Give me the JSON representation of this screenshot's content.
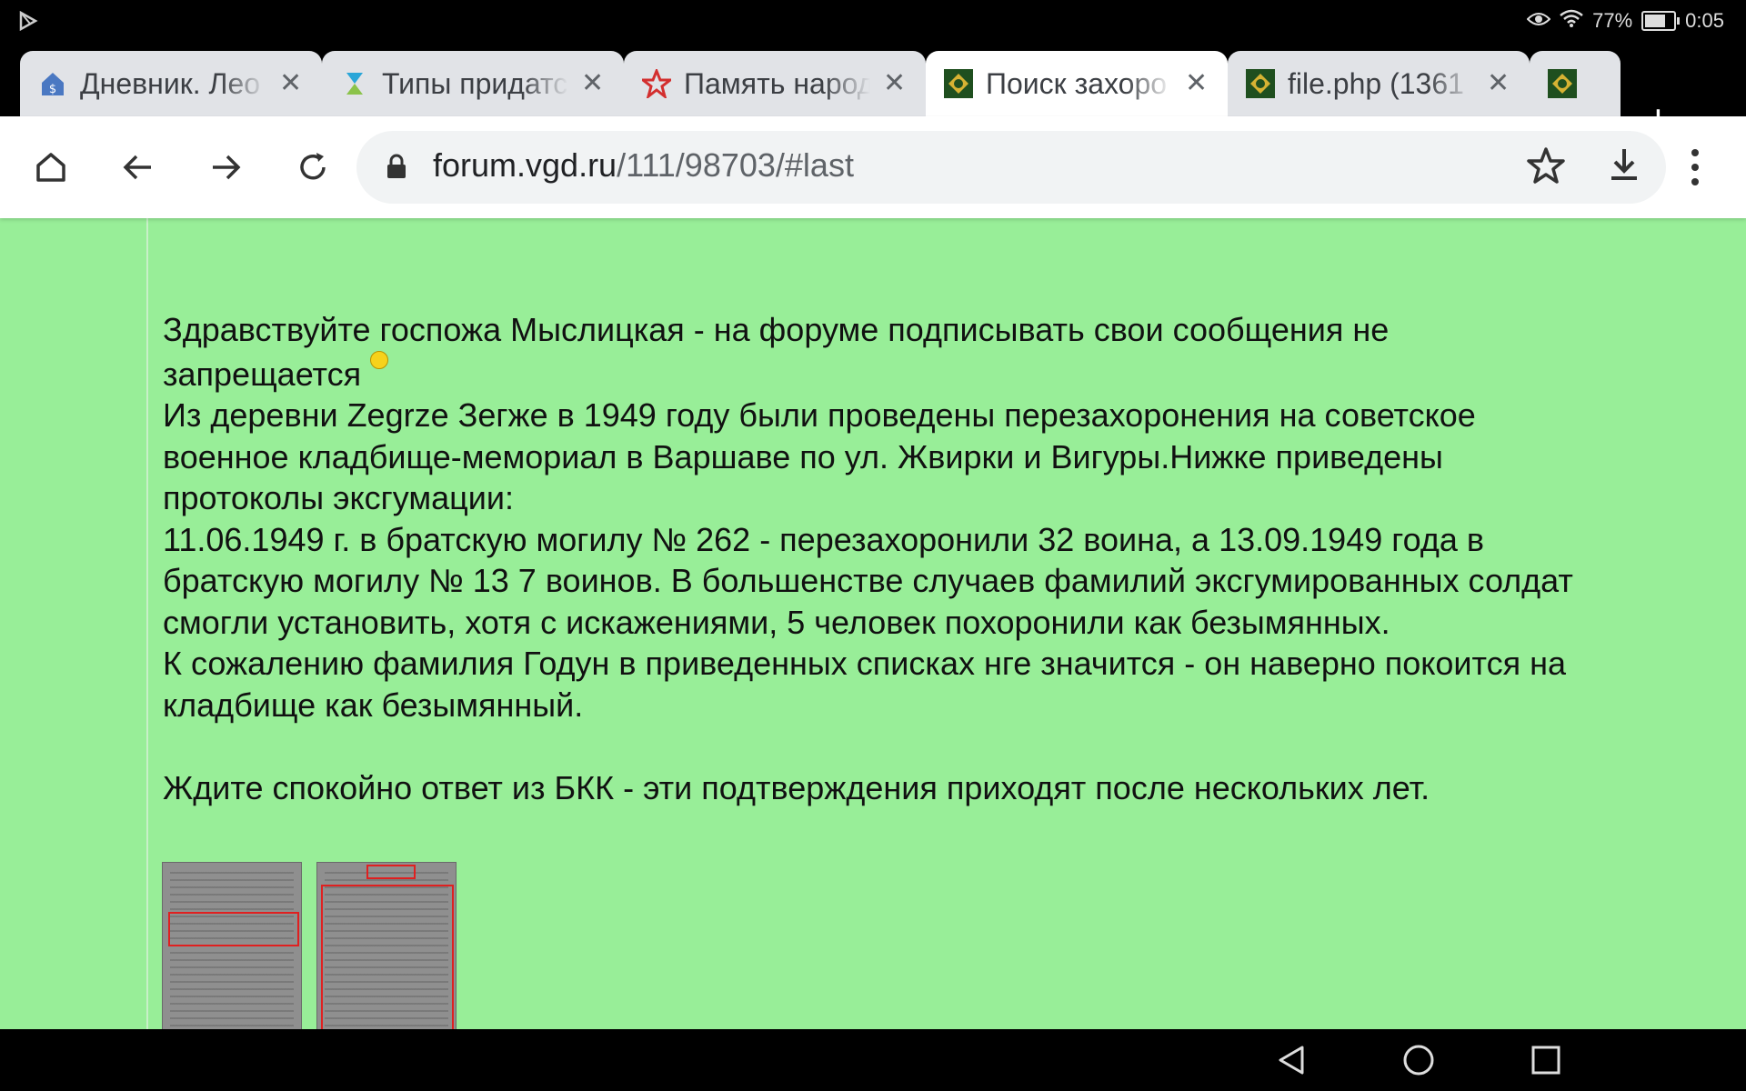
{
  "status_bar": {
    "battery": "77%",
    "time": "0:05",
    "battery_level": 0.77,
    "icons": [
      "play-store-icon",
      "eye-icon",
      "wifi-icon",
      "battery-icon"
    ]
  },
  "tabs": [
    {
      "title": "Дневник. Лео",
      "favicon": "house-favicon-icon",
      "active": false
    },
    {
      "title": "Типы придатс",
      "favicon": "hourglass-favicon-icon",
      "active": false
    },
    {
      "title": "Память народ",
      "favicon": "red-star-favicon-icon",
      "active": false
    },
    {
      "title": "Поиск захоро",
      "favicon": "vgd-favicon-icon",
      "active": true
    },
    {
      "title": "file.php (1361",
      "favicon": "vgd-favicon-icon",
      "active": false
    },
    {
      "title": "",
      "favicon": "vgd-favicon-icon",
      "active": false
    }
  ],
  "toolbar": {
    "url_host": "forum.vgd.ru",
    "url_path": "/111/98703/#last"
  },
  "post": {
    "line1": "Здравствуйте госпожа Мыслицкая - на форуме подписывать свои сообщения не",
    "line2": "запрещается",
    "para1": "Из деревни Zegrze Зегже в 1949 году были проведены перезахоронения на советское",
    "para1b": "военное кладбище-мемориал в Варшаве по ул. Жвирки и Вигуры.Нижке приведены",
    "para1c": "протоколы эксгумации:",
    "para2": "11.06.1949 г. в братскую могилу № 262 - перезахоронили 32 воина, а 13.09.1949 года в",
    "para2b": "братскую могилу № 13 7 воинов. В большенстве случаев фамилий эксгумированных солдат",
    "para2c": "смогли установить, хотя с искажениями, 5 человек похоронили как безымянных.",
    "para3": "К сожалению фамилия Годун в приведенных списках нге значится - он наверно покоится на",
    "para3b": "кладбище как безымянный.",
    "para4": "Ждите спокойно ответ из БКК - эти подтверждения приходят после нескольких лет."
  },
  "colors": {
    "page_bg": "#98ee98",
    "highlight_box": "#e02020"
  }
}
